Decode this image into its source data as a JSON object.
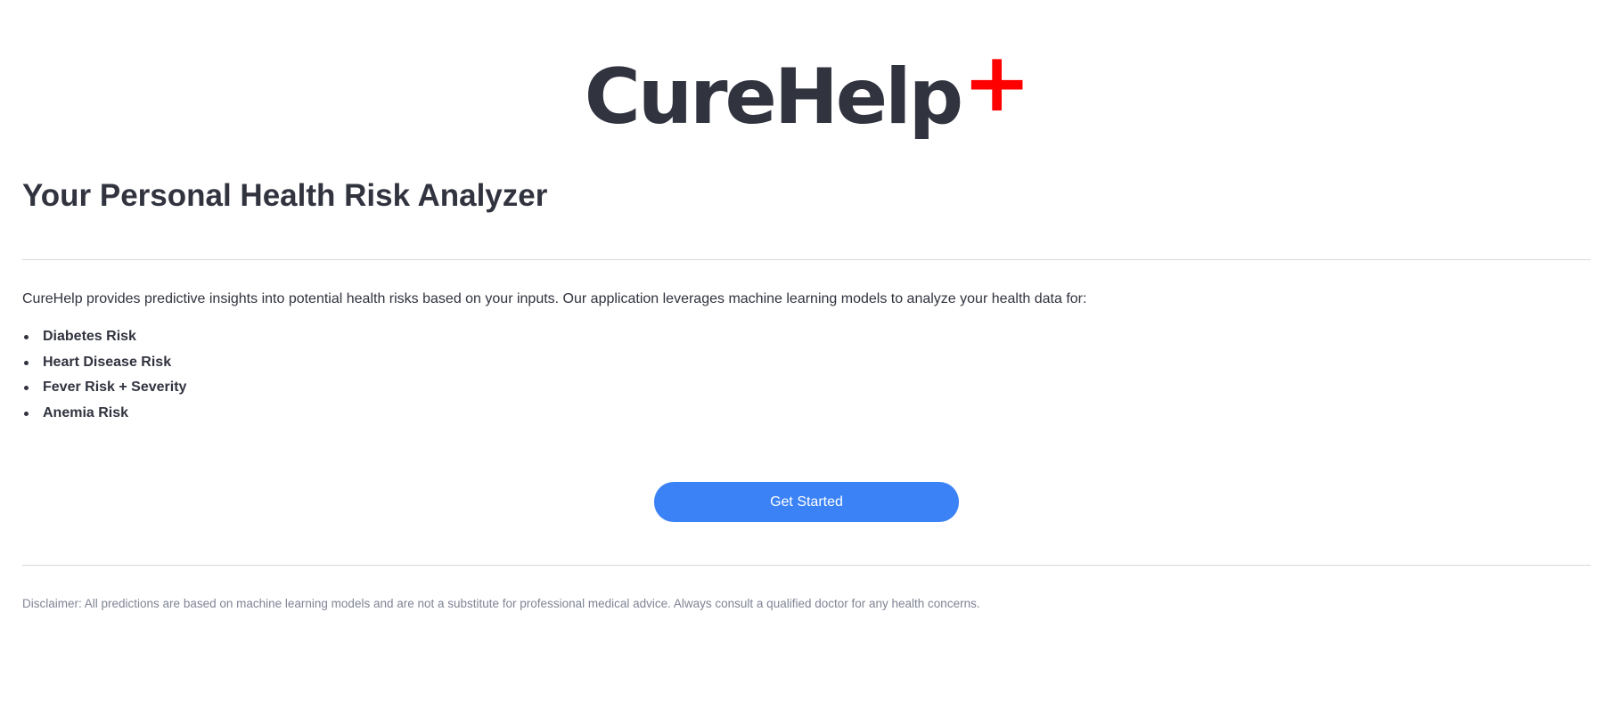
{
  "logo": {
    "text": "CureHelp",
    "mark": "+",
    "mark_color": "#ff0000"
  },
  "header": {
    "title": "Your Personal Health Risk Analyzer"
  },
  "intro": {
    "text": "CureHelp provides predictive insights into potential health risks based on your inputs. Our application leverages machine learning models to analyze your health data for:"
  },
  "risks": [
    {
      "label": "Diabetes Risk"
    },
    {
      "label": "Heart Disease Risk"
    },
    {
      "label": "Fever Risk + Severity"
    },
    {
      "label": "Anemia Risk"
    }
  ],
  "cta": {
    "label": "Get Started",
    "color": "#3b82f6"
  },
  "footer": {
    "disclaimer": "Disclaimer: All predictions are based on machine learning models and are not a substitute for professional medical advice. Always consult a qualified doctor for any health concerns."
  }
}
